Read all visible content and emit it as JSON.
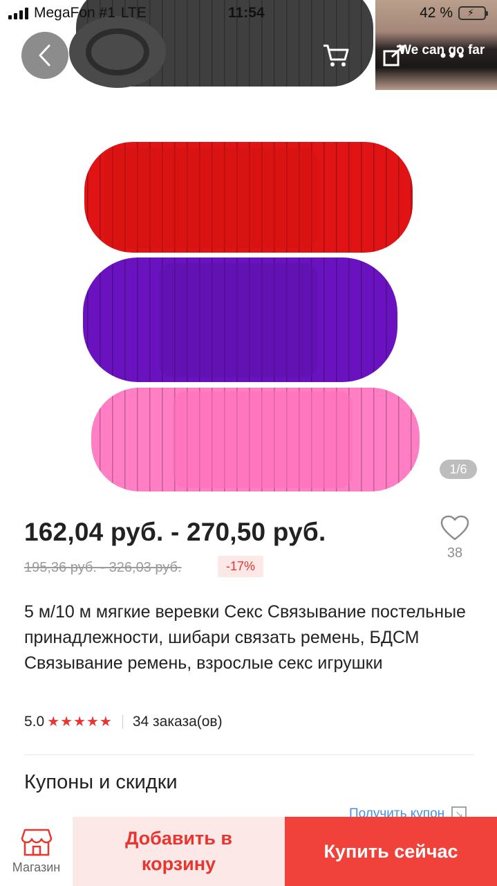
{
  "status_bar": {
    "carrier": "MegaFon #1",
    "network": "LTE",
    "time": "11:54",
    "battery_text": "42 %",
    "battery_level": 0.42
  },
  "gallery": {
    "page_indicator": "1/6",
    "thumbnail_watermark": "We can go far",
    "rope_colors": [
      "#3f3f3f",
      "#e01414",
      "#6a12bf",
      "#ff7ec4"
    ]
  },
  "icons": {
    "back": "chevron-left-icon",
    "cart": "cart-icon",
    "share": "share-icon",
    "more": "more-icon",
    "wish": "heart-icon",
    "shop": "store-icon"
  },
  "product": {
    "price": "162,04 руб. - 270,50 руб.",
    "old_price": "195,36 руб. - 326,03 руб.",
    "discount": "-17%",
    "wish_count": "38",
    "title": "5 м/10 м мягкие веревки Секс Связывание постельные принадлежности, шибари связать ремень, БДСМ Связывание ремень, взрослые секс игрушки",
    "rating": "5.0",
    "stars": "★★★★★",
    "orders": "34 заказа(ов)"
  },
  "coupons": {
    "title": "Купоны и скидки",
    "link": "Получить купон"
  },
  "bottom_bar": {
    "shop_label": "Магазин",
    "add_to_cart_label": "Добавить в корзину",
    "buy_now_label": "Купить сейчас"
  },
  "colors": {
    "accent": "#f0413b",
    "accent_light": "#fde8e8",
    "link": "#4a90d9"
  }
}
